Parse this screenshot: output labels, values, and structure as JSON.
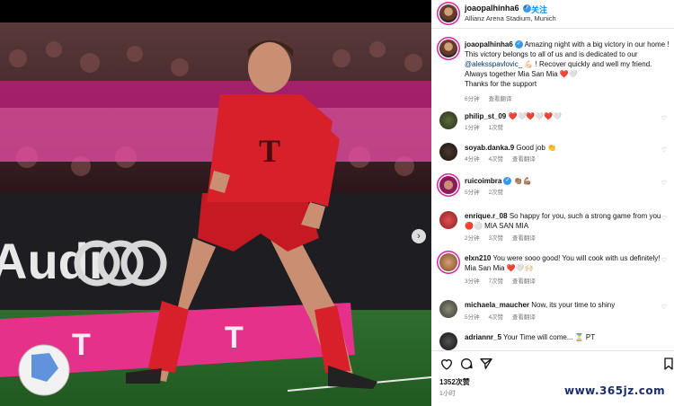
{
  "post": {
    "username": "joaopalhinha6",
    "follow_label": "关注",
    "separator": "•",
    "location": "Allianz Arena Stadium, Munich"
  },
  "caption": {
    "username": "joaopalhinha6",
    "line1": "Amazing night with a big victory in our home ! This victory belongs to all of us and is dedicated to our",
    "mention": "@aleksspavlovic_",
    "line2": "💪🏻 ! Recover quickly and well my friend. Always together Mia San Mia ❤️🤍",
    "line3": "Thanks for the support",
    "time": "6分钟",
    "translate": "查看翻译"
  },
  "comments": [
    {
      "username": "philip_st_09",
      "text": "❤️🤍❤️🤍❤️🤍",
      "time": "1分钟",
      "likes": "1次赞",
      "translate": ""
    },
    {
      "username": "soyab.danka.9",
      "text": "Good job 👏",
      "time": "4分钟",
      "likes": "4次赞",
      "translate": "查看翻译"
    },
    {
      "username": "ruicoimbra",
      "text": "👏🏽💪🏽",
      "time": "5分钟",
      "likes": "2次赞",
      "translate": ""
    },
    {
      "username": "enrique.r_08",
      "text": "So happy for you, such a strong game from you 🔴⚪ MIA SAN MIA",
      "time": "2分钟",
      "likes": "3次赞",
      "translate": "查看翻译"
    },
    {
      "username": "elxn210",
      "text": "You were sooo good! You will cook with us definitely! Mia San Mia ❤️🤍🙌🏻",
      "time": "3分钟",
      "likes": "7次赞",
      "translate": "查看翻译"
    },
    {
      "username": "michaela_maucher",
      "text": "Now, its your time to shiny",
      "time": "5分钟",
      "likes": "4次赞",
      "translate": "查看翻译"
    },
    {
      "username": "adriannr_5",
      "text": "Your Time will come... ⏳ PT",
      "time": "",
      "likes": "",
      "translate": ""
    }
  ],
  "actions": {
    "likes": "1352次赞",
    "date": "1小时"
  },
  "photo": {
    "jersey_letter": "T",
    "sponsor_text": "Audi"
  },
  "watermark": "www.365jz.com",
  "icons": {
    "next": "chevron-right-icon",
    "like": "heart-icon",
    "comment": "comment-icon",
    "share": "send-icon",
    "save": "bookmark-icon"
  },
  "colors": {
    "accent": "#0095f6",
    "jersey_red": "#d8202a",
    "pink_board": "#e5318a"
  }
}
